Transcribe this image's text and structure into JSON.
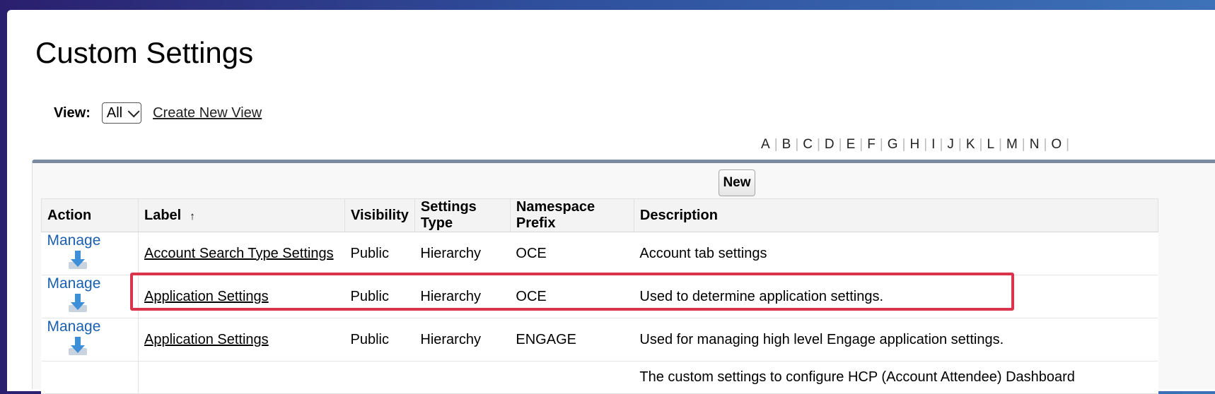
{
  "page_title": "Custom Settings",
  "view": {
    "label": "View:",
    "selected": "All",
    "create_link": "Create New View"
  },
  "alphabet": [
    "A",
    "B",
    "C",
    "D",
    "E",
    "F",
    "G",
    "H",
    "I",
    "J",
    "K",
    "L",
    "M",
    "N",
    "O"
  ],
  "new_button": "New",
  "columns": {
    "action": "Action",
    "label": "Label",
    "sort_indicator": "↑",
    "visibility": "Visibility",
    "settings_type": "Settings Type",
    "namespace": "Namespace Prefix",
    "description": "Description"
  },
  "rows": [
    {
      "action": "Manage",
      "label": "Account Search Type Settings",
      "visibility": "Public",
      "type": "Hierarchy",
      "namespace": "OCE",
      "description": "Account tab settings"
    },
    {
      "action": "Manage",
      "label": "Application Settings",
      "visibility": "Public",
      "type": "Hierarchy",
      "namespace": "OCE",
      "description": "Used to determine application settings."
    },
    {
      "action": "Manage",
      "label": "Application Settings",
      "visibility": "Public",
      "type": "Hierarchy",
      "namespace": "ENGAGE",
      "description": "Used for managing high level Engage application settings."
    },
    {
      "action": "",
      "label": "",
      "visibility": "",
      "type": "",
      "namespace": "",
      "description": "The custom settings to configure HCP (Account Attendee) Dashboard"
    }
  ],
  "colors": {
    "highlight": "#d9344b",
    "link": "#1a5fb0",
    "panel_border": "#7a8aa0"
  },
  "icons": {
    "row_action": "download-icon",
    "view_dropdown": "chevron-down-icon"
  }
}
